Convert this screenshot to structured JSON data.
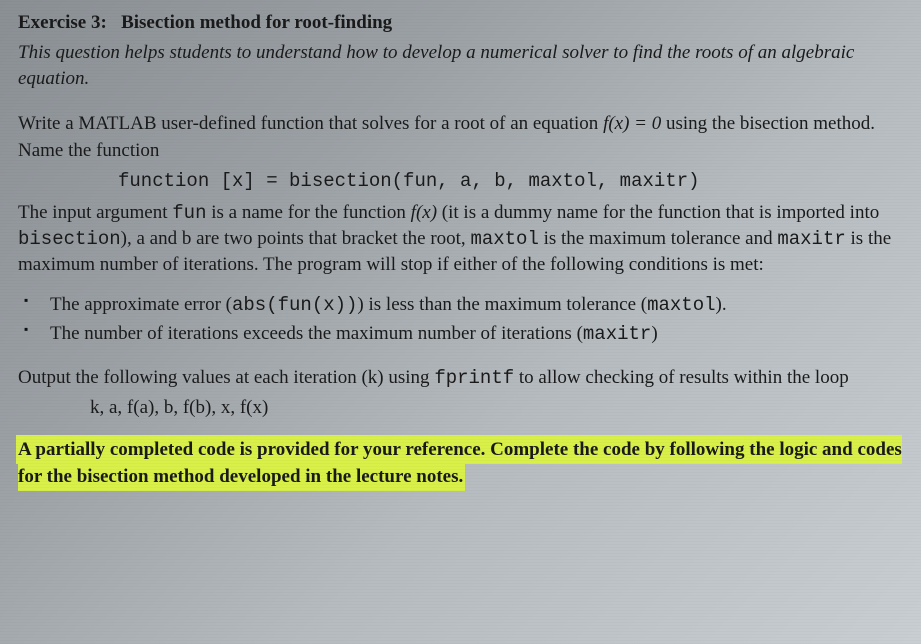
{
  "exercise": {
    "label": "Exercise 3:",
    "title": "Bisection method for root-finding"
  },
  "intro": "This question helps students to understand how to develop a numerical solver to find the roots of an algebraic equation.",
  "para1_a": "Write a MATLAB user-defined function that solves for a root of an equation ",
  "para1_eq": "f(x) = 0",
  "para1_b": " using the bisection method.  Name the function",
  "func_sig": "function [x] = bisection(fun, a, b, maxtol, maxitr)",
  "para2_a": "The input argument ",
  "code_fun": "fun",
  "para2_b": " is a name for the function ",
  "fx": "f(x)",
  "para2_c": " (it is a dummy name for the function that is imported into ",
  "code_bis": "bisection",
  "para2_d": "), a and b are two points that bracket the root, ",
  "code_maxtol": "maxtol",
  "para2_e": " is the maximum tolerance and ",
  "code_maxitr": "maxitr",
  "para2_f": " is the maximum number of iterations.  The program will stop if either of the following conditions is met:",
  "conditions": [
    {
      "a": "The approximate error (",
      "code": "abs(fun(x))",
      "b": ") is less than the maximum tolerance (",
      "code2": "maxtol",
      "c": ")."
    },
    {
      "a": "The number of iterations exceeds the maximum number of iterations (",
      "code": "maxitr",
      "b": ")",
      "code2": "",
      "c": ""
    }
  ],
  "para3_a": "Output the following values at each iteration (k) using ",
  "code_fprintf": "fprintf",
  "para3_b": " to allow checking of results within the loop",
  "outvals": "k, a, f(a), b, f(b), x,  f(x)",
  "highlight": "A partially completed code is provided for your reference.  Complete the code by following the logic and codes for the bisection method developed in the lecture notes."
}
